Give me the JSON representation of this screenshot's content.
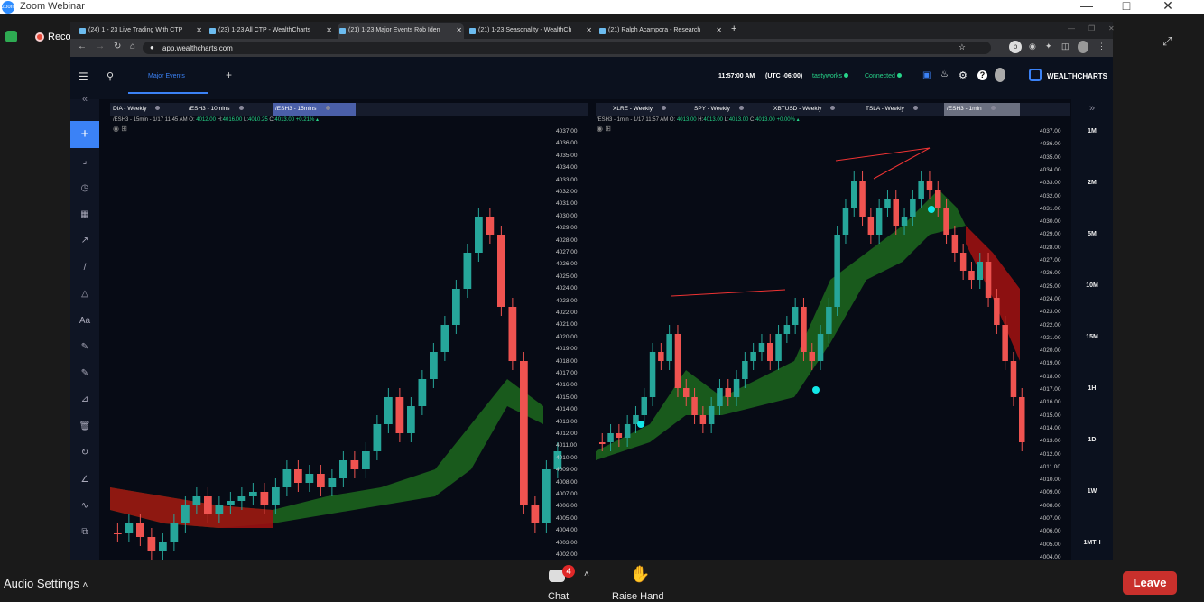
{
  "zoom": {
    "title": "Zoom Webinar",
    "recording_label": "Recording",
    "audio_settings_label": "Audio Settings",
    "chat_label": "Chat",
    "chat_badge": "4",
    "raise_hand_label": "Raise Hand",
    "leave_label": "Leave",
    "leave_color": "#c9302c"
  },
  "browser": {
    "tabs": [
      "(24) 1 - 23 Live Trading With CTP",
      "(23) 1-23 All CTP - WealthCharts",
      "(21) 1-23 Major Events Rob Iden",
      "(21) 1-23 Seasonality - WealthCh",
      "(21) Ralph Acampora - Research"
    ],
    "active_tab": 2,
    "url": "app.wealthcharts.com"
  },
  "app": {
    "active_tab": "Major Events",
    "time": "11:57:00 AM",
    "timezone": "(UTC -06:00)",
    "broker": "tastyworks",
    "connection": "Connected",
    "brand": "WEALTHCHARTS",
    "accent_color": "#3b82f6",
    "up_color": "#26a69a",
    "down_color": "#ef5350"
  },
  "left_pane": {
    "tabs": [
      "DIA - Weekly",
      "/ESH3 - 10mins",
      "/ESH3 - 15mins"
    ],
    "selected": 2,
    "ohlc_prefix": "/ESH3 - 15min - 1/17 11:45 AM",
    "ohlc_o": "4012.00",
    "ohlc_h": "4016.00",
    "ohlc_l": "4010.25",
    "ohlc_c": "4013.00",
    "ohlc_chg": "+0.21%",
    "price_labels": [
      "4037.00",
      "4036.00",
      "4035.00",
      "4034.00",
      "4033.00",
      "4032.00",
      "4031.00",
      "4030.00",
      "4029.00",
      "4028.00",
      "4027.00",
      "4026.00",
      "4025.00",
      "4024.00",
      "4023.00",
      "4022.00",
      "4021.00",
      "4020.00",
      "4019.00",
      "4018.00",
      "4017.00",
      "4016.00",
      "4015.00",
      "4014.00",
      "4013.00",
      "4012.00",
      "4011.00",
      "4010.00",
      "4009.00",
      "4008.00",
      "4007.00",
      "4006.00",
      "4005.00",
      "4004.00",
      "4003.00",
      "4002.00"
    ]
  },
  "right_pane": {
    "tabs": [
      "XLRE - Weekly",
      "SPY - Weekly",
      "XBTUSD - Weekly",
      "TSLA - Weekly",
      "/ESH3 - 1min"
    ],
    "selected": 4,
    "ohlc_prefix": "/ESH3 - 1min - 1/17 11:57 AM",
    "ohlc_o": "4013.00",
    "ohlc_h": "4013.00",
    "ohlc_l": "4013.00",
    "ohlc_c": "4013.00",
    "ohlc_chg": "+0.00%",
    "price_labels": [
      "4037.00",
      "4036.00",
      "4035.00",
      "4034.00",
      "4033.00",
      "4032.00",
      "4031.00",
      "4030.00",
      "4029.00",
      "4028.00",
      "4027.00",
      "4026.00",
      "4025.00",
      "4024.00",
      "4023.00",
      "4022.00",
      "4021.00",
      "4020.00",
      "4019.00",
      "4018.00",
      "4017.00",
      "4016.00",
      "4015.00",
      "4014.00",
      "4013.00",
      "4012.00",
      "4011.00",
      "4010.00",
      "4009.00",
      "4008.00",
      "4007.00",
      "4006.00",
      "4005.00",
      "4004.00"
    ]
  },
  "timeframes": [
    "1M",
    "2M",
    "5M",
    "10M",
    "15M",
    "1H",
    "1D",
    "1W",
    "1MTH"
  ]
}
